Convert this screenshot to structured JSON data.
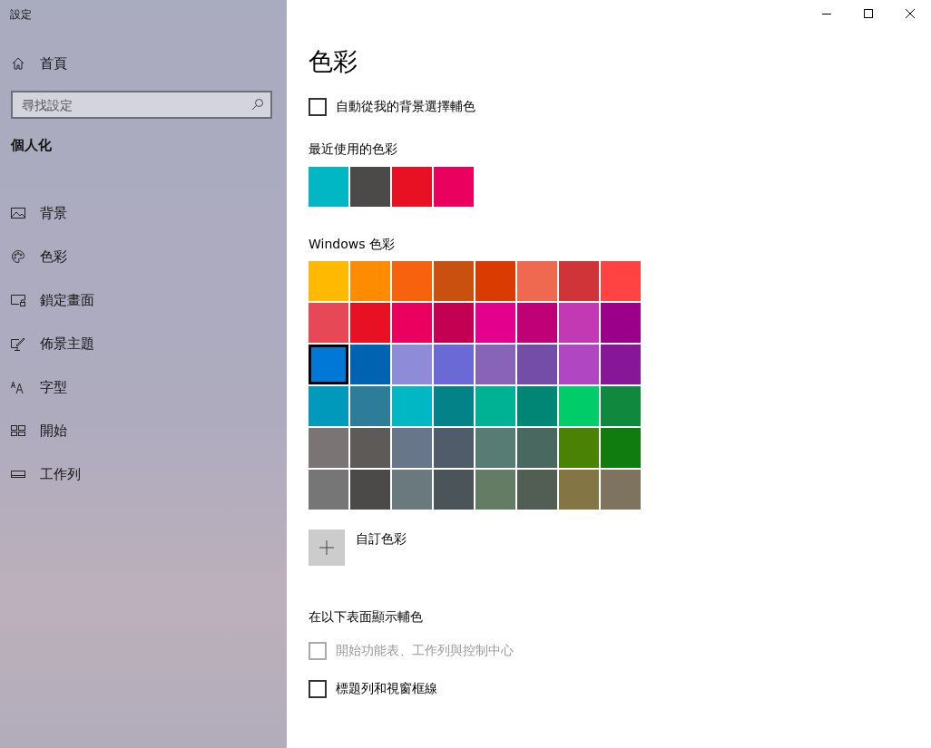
{
  "window": {
    "title": "設定"
  },
  "sidebar": {
    "home": {
      "label": "首頁"
    },
    "search": {
      "placeholder": "尋找設定"
    },
    "section": "個人化",
    "items": [
      {
        "label": "背景"
      },
      {
        "label": "色彩"
      },
      {
        "label": "鎖定畫面"
      },
      {
        "label": "佈景主題"
      },
      {
        "label": "字型"
      },
      {
        "label": "開始"
      },
      {
        "label": "工作列"
      }
    ]
  },
  "page": {
    "title": "色彩",
    "auto_accent": {
      "label": "自動從我的背景選擇輔色",
      "checked": false,
      "disabled": false
    },
    "recent": {
      "heading": "最近使用的色彩",
      "swatches": [
        {
          "color": "#00b7c3"
        },
        {
          "color": "#4c4a48"
        },
        {
          "color": "#e81123"
        },
        {
          "color": "#ea005e"
        }
      ]
    },
    "windows_colors": {
      "heading": "Windows 色彩",
      "swatches": [
        {
          "color": "#ffb900",
          "selected": false
        },
        {
          "color": "#ff8c00",
          "selected": false
        },
        {
          "color": "#f7630c",
          "selected": false
        },
        {
          "color": "#ca5010",
          "selected": false
        },
        {
          "color": "#da3b01",
          "selected": false
        },
        {
          "color": "#ef6950",
          "selected": false
        },
        {
          "color": "#d13438",
          "selected": false
        },
        {
          "color": "#ff4343",
          "selected": false
        },
        {
          "color": "#e74856",
          "selected": false
        },
        {
          "color": "#e81123",
          "selected": false
        },
        {
          "color": "#ea005e",
          "selected": false
        },
        {
          "color": "#c30052",
          "selected": false
        },
        {
          "color": "#e3008c",
          "selected": false
        },
        {
          "color": "#bf0077",
          "selected": false
        },
        {
          "color": "#c239b3",
          "selected": false
        },
        {
          "color": "#9a0089",
          "selected": false
        },
        {
          "color": "#0078d7",
          "selected": true
        },
        {
          "color": "#0063b1",
          "selected": false
        },
        {
          "color": "#8e8cd8",
          "selected": false
        },
        {
          "color": "#6b69d6",
          "selected": false
        },
        {
          "color": "#8764b8",
          "selected": false
        },
        {
          "color": "#744da9",
          "selected": false
        },
        {
          "color": "#b146c2",
          "selected": false
        },
        {
          "color": "#881798",
          "selected": false
        },
        {
          "color": "#0099bc",
          "selected": false
        },
        {
          "color": "#2d7d9a",
          "selected": false
        },
        {
          "color": "#00b7c3",
          "selected": false
        },
        {
          "color": "#038387",
          "selected": false
        },
        {
          "color": "#00b294",
          "selected": false
        },
        {
          "color": "#018574",
          "selected": false
        },
        {
          "color": "#00cc6a",
          "selected": false
        },
        {
          "color": "#10893e",
          "selected": false
        },
        {
          "color": "#7a7574",
          "selected": false
        },
        {
          "color": "#5d5a58",
          "selected": false
        },
        {
          "color": "#68768a",
          "selected": false
        },
        {
          "color": "#515c6b",
          "selected": false
        },
        {
          "color": "#567c73",
          "selected": false
        },
        {
          "color": "#486860",
          "selected": false
        },
        {
          "color": "#498205",
          "selected": false
        },
        {
          "color": "#107c10",
          "selected": false
        },
        {
          "color": "#767676",
          "selected": false
        },
        {
          "color": "#4c4a48",
          "selected": false
        },
        {
          "color": "#69797e",
          "selected": false
        },
        {
          "color": "#4a5459",
          "selected": false
        },
        {
          "color": "#647c64",
          "selected": false
        },
        {
          "color": "#525e54",
          "selected": false
        },
        {
          "color": "#847545",
          "selected": false
        },
        {
          "color": "#7e735f",
          "selected": false
        }
      ]
    },
    "custom_color": {
      "label": "自訂色彩"
    },
    "surfaces": {
      "heading": "在以下表面顯示輔色",
      "options": [
        {
          "label": "開始功能表、工作列與控制中心",
          "checked": false,
          "disabled": true
        },
        {
          "label": "標題列和視窗框線",
          "checked": false,
          "disabled": false
        }
      ]
    }
  }
}
